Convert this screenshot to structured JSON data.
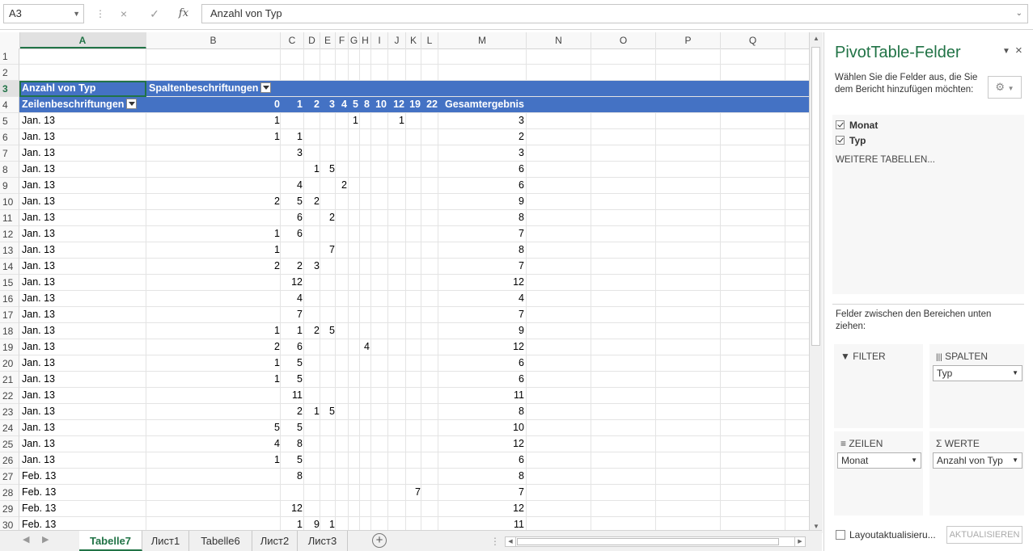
{
  "namebox": {
    "value": "A3"
  },
  "formula": {
    "value": "Anzahl von Typ",
    "fx": "fx",
    "cancel": "×",
    "enter": "✓"
  },
  "columns": [
    "A",
    "B",
    "C",
    "D",
    "E",
    "F",
    "G",
    "H",
    "I",
    "J",
    "K",
    "L",
    "M",
    "N",
    "O",
    "P",
    "Q"
  ],
  "selected_column": "A",
  "rows": [
    1,
    2,
    3,
    4,
    5,
    6,
    7,
    8,
    9,
    10,
    11,
    12,
    13,
    14,
    15,
    16,
    17,
    18,
    19,
    20,
    21,
    22,
    23,
    24,
    25,
    26,
    27,
    28,
    29,
    30
  ],
  "pivot": {
    "header1": {
      "label": "Anzahl von Typ",
      "col_label": "Spaltenbeschriftungen"
    },
    "header2": {
      "row_label": "Zeilenbeschriftungen",
      "cols": [
        "0",
        "1",
        "2",
        "3",
        "4",
        "5",
        "8",
        "10",
        "12",
        "19",
        "22"
      ],
      "total": "Gesamtergebnis"
    },
    "data": [
      {
        "label": "Jan. 13",
        "v": [
          "1",
          "",
          "",
          "",
          "",
          "1",
          "",
          "",
          "1",
          "",
          ""
        ],
        "t": "3"
      },
      {
        "label": "Jan. 13",
        "v": [
          "1",
          "1",
          "",
          "",
          "",
          "",
          "",
          "",
          "",
          "",
          ""
        ],
        "t": "2"
      },
      {
        "label": "Jan. 13",
        "v": [
          "",
          "3",
          "",
          "",
          "",
          "",
          "",
          "",
          "",
          "",
          ""
        ],
        "t": "3"
      },
      {
        "label": "Jan. 13",
        "v": [
          "",
          "",
          "1",
          "5",
          "",
          "",
          "",
          "",
          "",
          "",
          ""
        ],
        "t": "6"
      },
      {
        "label": "Jan. 13",
        "v": [
          "",
          "4",
          "",
          "",
          "2",
          "",
          "",
          "",
          "",
          "",
          ""
        ],
        "t": "6"
      },
      {
        "label": "Jan. 13",
        "v": [
          "2",
          "5",
          "2",
          "",
          "",
          "",
          "",
          "",
          "",
          "",
          ""
        ],
        "t": "9"
      },
      {
        "label": "Jan. 13",
        "v": [
          "",
          "6",
          "",
          "2",
          "",
          "",
          "",
          "",
          "",
          "",
          ""
        ],
        "t": "8"
      },
      {
        "label": "Jan. 13",
        "v": [
          "1",
          "6",
          "",
          "",
          "",
          "",
          "",
          "",
          "",
          "",
          ""
        ],
        "t": "7"
      },
      {
        "label": "Jan. 13",
        "v": [
          "1",
          "",
          "",
          "7",
          "",
          "",
          "",
          "",
          "",
          "",
          ""
        ],
        "t": "8"
      },
      {
        "label": "Jan. 13",
        "v": [
          "2",
          "2",
          "3",
          "",
          "",
          "",
          "",
          "",
          "",
          "",
          ""
        ],
        "t": "7"
      },
      {
        "label": "Jan. 13",
        "v": [
          "",
          "12",
          "",
          "",
          "",
          "",
          "",
          "",
          "",
          "",
          ""
        ],
        "t": "12"
      },
      {
        "label": "Jan. 13",
        "v": [
          "",
          "4",
          "",
          "",
          "",
          "",
          "",
          "",
          "",
          "",
          ""
        ],
        "t": "4"
      },
      {
        "label": "Jan. 13",
        "v": [
          "",
          "7",
          "",
          "",
          "",
          "",
          "",
          "",
          "",
          "",
          ""
        ],
        "t": "7"
      },
      {
        "label": "Jan. 13",
        "v": [
          "1",
          "1",
          "2",
          "5",
          "",
          "",
          "",
          "",
          "",
          "",
          ""
        ],
        "t": "9"
      },
      {
        "label": "Jan. 13",
        "v": [
          "2",
          "6",
          "",
          "",
          "",
          "",
          "4",
          "",
          "",
          "",
          ""
        ],
        "t": "12"
      },
      {
        "label": "Jan. 13",
        "v": [
          "1",
          "5",
          "",
          "",
          "",
          "",
          "",
          "",
          "",
          "",
          ""
        ],
        "t": "6"
      },
      {
        "label": "Jan. 13",
        "v": [
          "1",
          "5",
          "",
          "",
          "",
          "",
          "",
          "",
          "",
          "",
          ""
        ],
        "t": "6"
      },
      {
        "label": "Jan. 13",
        "v": [
          "",
          "11",
          "",
          "",
          "",
          "",
          "",
          "",
          "",
          "",
          ""
        ],
        "t": "11"
      },
      {
        "label": "Jan. 13",
        "v": [
          "",
          "2",
          "1",
          "5",
          "",
          "",
          "",
          "",
          "",
          "",
          ""
        ],
        "t": "8"
      },
      {
        "label": "Jan. 13",
        "v": [
          "5",
          "5",
          "",
          "",
          "",
          "",
          "",
          "",
          "",
          "",
          ""
        ],
        "t": "10"
      },
      {
        "label": "Jan. 13",
        "v": [
          "4",
          "8",
          "",
          "",
          "",
          "",
          "",
          "",
          "",
          "",
          ""
        ],
        "t": "12"
      },
      {
        "label": "Jan. 13",
        "v": [
          "1",
          "5",
          "",
          "",
          "",
          "",
          "",
          "",
          "",
          "",
          ""
        ],
        "t": "6"
      },
      {
        "label": "Feb. 13",
        "v": [
          "",
          "8",
          "",
          "",
          "",
          "",
          "",
          "",
          "",
          "",
          ""
        ],
        "t": "8"
      },
      {
        "label": "Feb. 13",
        "v": [
          "",
          "",
          "",
          "",
          "",
          "",
          "",
          "",
          "",
          "7",
          ""
        ],
        "t": "7"
      },
      {
        "label": "Feb. 13",
        "v": [
          "",
          "12",
          "",
          "",
          "",
          "",
          "",
          "",
          "",
          "",
          ""
        ],
        "t": "12"
      },
      {
        "label": "Feb. 13",
        "v": [
          "",
          "1",
          "9",
          "1",
          "",
          "",
          "",
          "",
          "",
          "",
          ""
        ],
        "t": "11"
      }
    ]
  },
  "sheets": [
    {
      "name": "Tabelle7",
      "active": true
    },
    {
      "name": "Лист1",
      "active": false
    },
    {
      "name": "Tabelle6",
      "active": false
    },
    {
      "name": "Лист2",
      "active": false
    },
    {
      "name": "Лист3",
      "active": false
    }
  ],
  "pane": {
    "title": "PivotTable-Felder",
    "description": "Wählen Sie die Felder aus, die Sie dem Bericht hinzufügen möchten:",
    "fields": [
      {
        "name": "Monat",
        "checked": true
      },
      {
        "name": "Typ",
        "checked": true
      }
    ],
    "more_tables": "WEITERE TABELLEN...",
    "areas_description": "Felder zwischen den Bereichen unten ziehen:",
    "filter_label": "FILTER",
    "columns_label": "SPALTEN",
    "columns_value": "Typ",
    "rows_label": "ZEILEN",
    "rows_value": "Monat",
    "values_label": "WERTE",
    "values_value": "Anzahl von Typ",
    "defer_label": "Layoutaktualisieru...",
    "update_button": "AKTUALISIEREN"
  },
  "colors": {
    "accent": "#217346",
    "pivot_header": "#4472c4"
  }
}
